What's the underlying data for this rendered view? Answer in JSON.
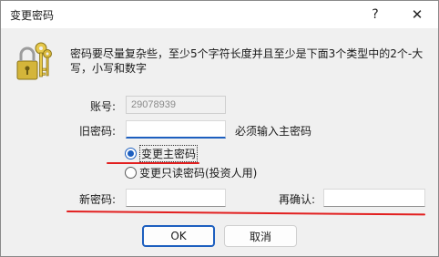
{
  "window": {
    "title": "变更密码",
    "help_label": "?",
    "close_label": "✕"
  },
  "description": "密码要尽量复杂些，至少5个字符长度并且至少是下面3个类型中的2个-大写，小写和数字",
  "form": {
    "account_label": "账号:",
    "account_value": "29078939",
    "old_password_label": "旧密码:",
    "old_password_value": "",
    "old_password_hint": "必须输入主密码",
    "radio_master_label": "变更主密码",
    "radio_master_checked": true,
    "radio_readonly_label": "变更只读密码(投资人用)",
    "radio_readonly_checked": false,
    "new_password_label": "新密码:",
    "new_password_value": "",
    "confirm_label": "再确认:",
    "confirm_value": ""
  },
  "buttons": {
    "ok": "OK",
    "cancel": "取消"
  },
  "annotation_color": "#e21f1f",
  "accent_color": "#1d5fbf",
  "icons": [
    "keys-lock-icon",
    "help-icon",
    "close-icon"
  ]
}
